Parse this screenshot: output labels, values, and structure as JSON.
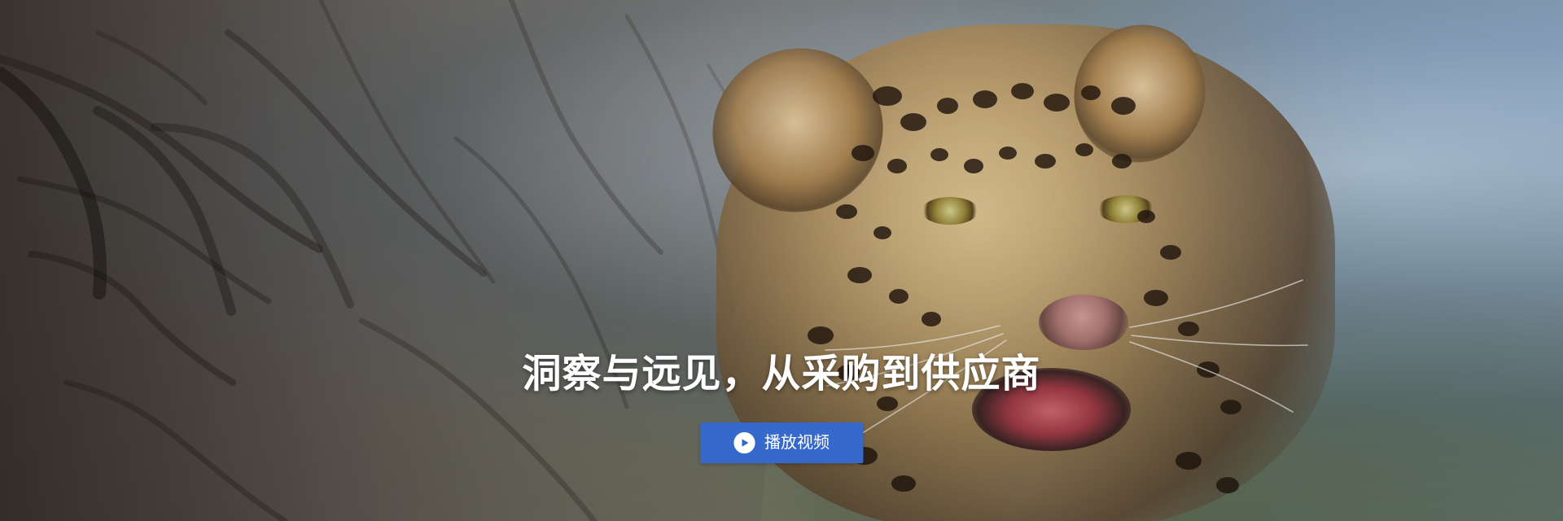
{
  "hero": {
    "headline": "洞察与远见，从采购到供应商",
    "cta": {
      "label": "播放视频",
      "icon": "play-icon"
    }
  },
  "colors": {
    "button_bg": "#3569cc",
    "title_text": "#ffffff"
  }
}
